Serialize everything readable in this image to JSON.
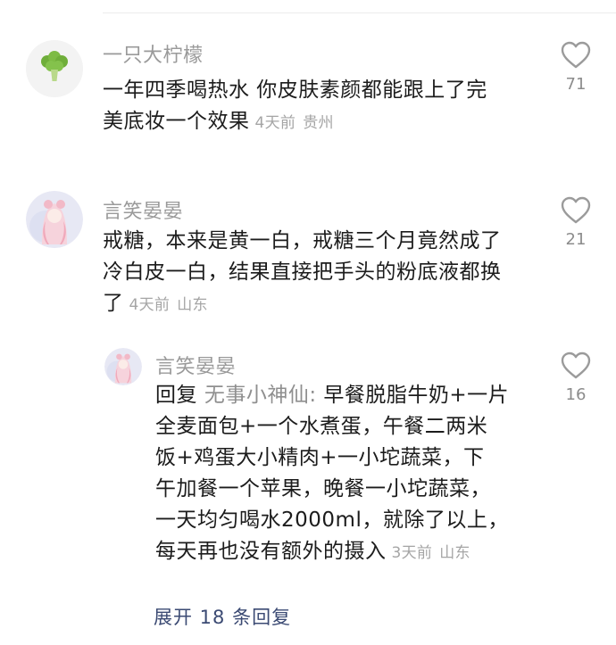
{
  "comments": [
    {
      "username": "一只大柠檬",
      "lines": [
        "一年四季喝热水 你皮肤素颜都能跟上了完",
        "美底妆一个效果"
      ],
      "time": "4天前",
      "location": "贵州",
      "likes": "71",
      "avatar_icon": "broccoli-icon"
    },
    {
      "username": "言笑晏晏",
      "lines": [
        "戒糖，本来是黄一白，戒糖三个月竟然成了",
        "冷白皮一白，结果直接把手头的粉底液都换",
        "了"
      ],
      "time": "4天前",
      "location": "山东",
      "likes": "21",
      "avatar_icon": "anime-girl-avatar-icon"
    }
  ],
  "reply": {
    "username": "言笑晏晏",
    "prefix": "回复",
    "mention": "无事小神仙:",
    "first_line_rest": " 早餐脱脂牛奶+一片",
    "lines": [
      "全麦面包+一个水煮蛋，午餐二两米",
      "饭+鸡蛋大小精肉+一小坨蔬菜，下",
      "午加餐一个苹果，晚餐一小坨蔬菜，",
      "一天均匀喝水2000ml，就除了以上，",
      "每天再也没有额外的摄入"
    ],
    "time": "3天前",
    "location": "山东",
    "likes": "16",
    "avatar_icon": "anime-girl-avatar-icon"
  },
  "expand_label": "展开 18 条回复",
  "colors": {
    "accent": "#3b4a73",
    "muted": "#9a9a9a"
  }
}
